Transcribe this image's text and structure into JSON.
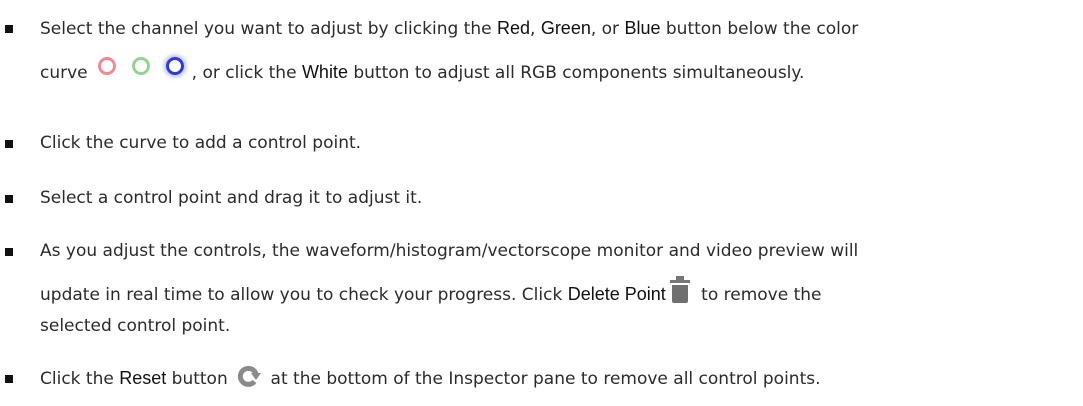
{
  "items": [
    {
      "line1_a": "Select the channel you want to adjust by clicking the ",
      "kw_red": "Red",
      "sep1": ", ",
      "kw_green": "Green",
      "sep2": ", or ",
      "kw_blue": "Blue",
      "line1_b": " button below the color",
      "line2_a": "curve",
      "line2_b": ", or click the ",
      "kw_white": "White",
      "line2_c": " button to adjust all RGB components simultaneously."
    },
    {
      "text": "Click the curve to add a control point."
    },
    {
      "text": "Select a control point and drag it to adjust it."
    },
    {
      "line1": "As you adjust the controls, the waveform/histogram/vectorscope monitor and video preview will",
      "line2_a": "update in real time to allow you to check your progress. Click ",
      "kw_delete": "Delete Point",
      "line2_b": " to remove the",
      "line3": "selected control point."
    },
    {
      "a": "Click the ",
      "kw_reset": "Reset",
      "b": " button ",
      "c": " at the bottom of the Inspector pane to remove all control points."
    }
  ],
  "icons": {
    "red_channel": "red-channel-icon",
    "green_channel": "green-channel-icon",
    "blue_channel": "blue-channel-icon",
    "delete": "trash-icon",
    "reset": "reset-icon"
  },
  "colors": {
    "red_ring": "#ee8a90",
    "green_ring": "#92d48f",
    "blue_ring": "#2d3bd6",
    "reset_icon": "#8a8a8a"
  }
}
